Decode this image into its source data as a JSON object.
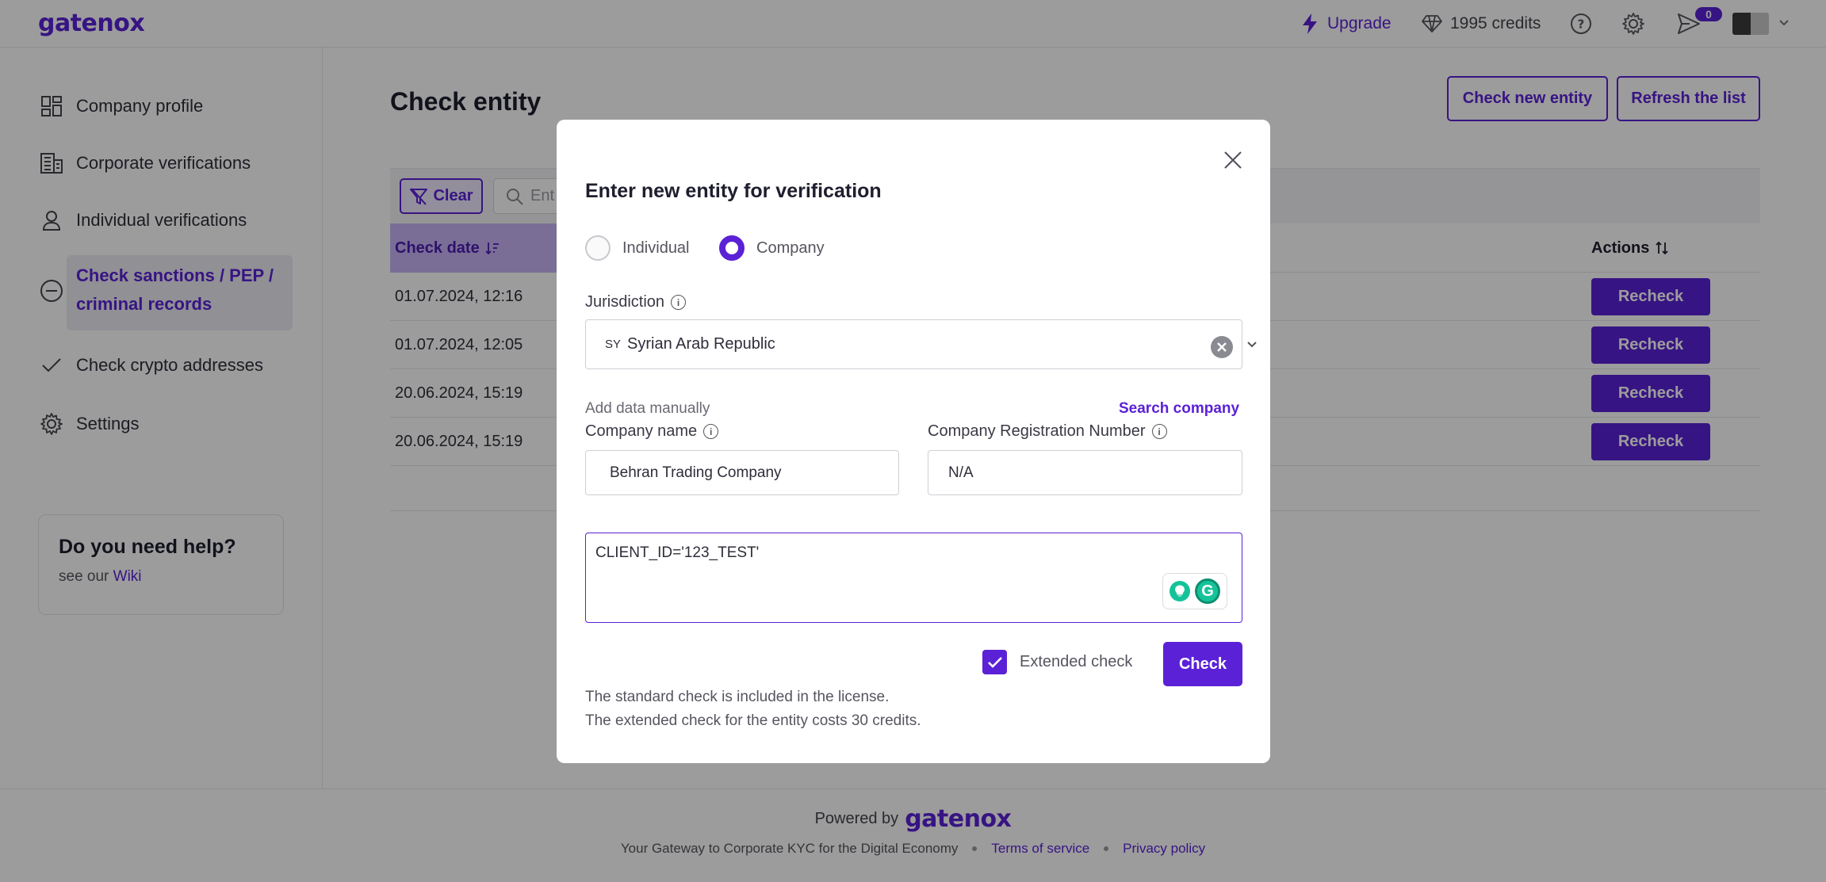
{
  "app": {
    "logo_text": "gatenox",
    "accent_color": "#5b21d6"
  },
  "topbar": {
    "upgrade_label": "Upgrade",
    "credits_label": "1995 credits",
    "notification_count": "0"
  },
  "sidebar": {
    "items": [
      {
        "label": "Company profile",
        "icon": "grid-icon"
      },
      {
        "label": "Corporate verifications",
        "icon": "building-icon"
      },
      {
        "label": "Individual verifications",
        "icon": "person-icon"
      },
      {
        "label": "Check sanctions / PEP / criminal records",
        "icon": "minus-circle-icon",
        "active": true
      },
      {
        "label": "Check crypto addresses",
        "icon": "check-icon"
      },
      {
        "label": "Settings",
        "icon": "gear-icon"
      }
    ],
    "help": {
      "title": "Do you need help?",
      "prefix": "see our",
      "link": "Wiki"
    }
  },
  "main": {
    "title": "Check entity",
    "check_new_label": "Check new entity",
    "refresh_label": "Refresh the list",
    "clear_label": "Clear",
    "search_placeholder": "Ent",
    "columns": {
      "date": "Check date",
      "actions": "Actions"
    },
    "rows": [
      {
        "date": "01.07.2024, 12:16",
        "action": "Recheck"
      },
      {
        "date": "01.07.2024, 12:05",
        "action": "Recheck"
      },
      {
        "date": "20.06.2024, 15:19",
        "action": "Recheck"
      },
      {
        "date": "20.06.2024, 15:19",
        "action": "Recheck"
      }
    ]
  },
  "modal": {
    "title": "Enter new entity for verification",
    "entity_types": [
      {
        "label": "Individual",
        "selected": false
      },
      {
        "label": "Company",
        "selected": true
      }
    ],
    "jurisdiction_label": "Jurisdiction",
    "jurisdiction_code": "SY",
    "jurisdiction_value": "Syrian Arab Republic",
    "add_manually_label": "Add data manually",
    "search_company_label": "Search company",
    "company_name_label": "Company name",
    "company_name_value": "Behran Trading Company",
    "reg_number_label": "Company Registration Number",
    "reg_number_value": "N/A",
    "notes_value": "CLIENT_ID='123_TEST'",
    "extended_check_label": "Extended check",
    "extended_check_checked": true,
    "check_button": "Check",
    "note_standard": "The standard check is included in the license.",
    "note_extended": "The extended check for the entity costs 30 credits."
  },
  "footer": {
    "powered_by": "Powered by",
    "logo_text": "gatenox",
    "tagline": "Your Gateway to Corporate KYC for the Digital Economy",
    "terms": "Terms of service",
    "privacy": "Privacy policy"
  }
}
